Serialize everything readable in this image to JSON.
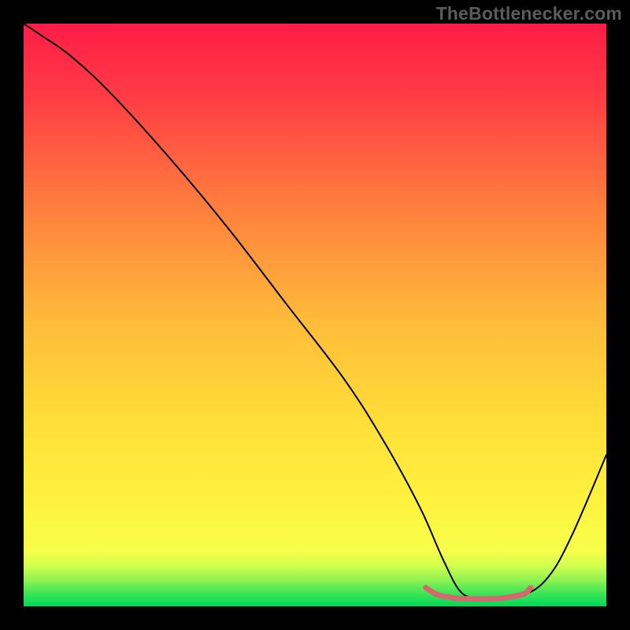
{
  "watermark": "TheBottlenecker.com",
  "chart_data": {
    "type": "line",
    "title": "",
    "xlabel": "",
    "ylabel": "",
    "xlim": [
      0,
      100
    ],
    "ylim": [
      0,
      100
    ],
    "gradient": {
      "top_color": "#ff1a47",
      "mid_color": "#ffd400",
      "green_band_top": "#e8ff4a",
      "green_band_bottom": "#00d858"
    },
    "series": [
      {
        "name": "bottleneck-curve",
        "color": "#000000",
        "x": [
          0,
          3,
          8,
          15,
          25,
          35,
          45,
          55,
          62,
          68,
          72,
          75,
          78,
          82,
          86,
          90,
          94,
          100
        ],
        "y": [
          100,
          98,
          94.5,
          88,
          77,
          65,
          52,
          39,
          28,
          17,
          8,
          2.5,
          1.5,
          1.5,
          2,
          5,
          12,
          26
        ]
      },
      {
        "name": "highlight-flat-region",
        "color": "#d5686e",
        "stroke_width": 7,
        "x": [
          69,
          71,
          73,
          74,
          76,
          78,
          80,
          82,
          84,
          86,
          87
        ],
        "y": [
          3.2,
          2.0,
          1.6,
          1.4,
          1.3,
          1.3,
          1.3,
          1.4,
          1.7,
          2.2,
          3.2
        ]
      }
    ]
  }
}
